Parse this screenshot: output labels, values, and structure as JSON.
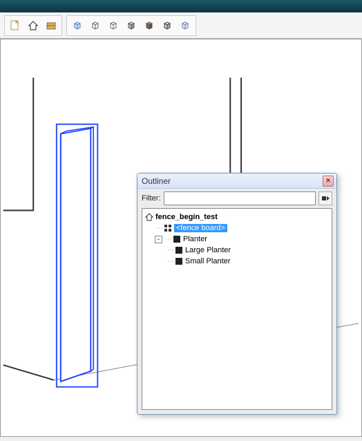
{
  "toolbar": {
    "std_buttons": [
      "new",
      "home",
      "save"
    ],
    "layer_buttons": [
      "iso",
      "wire",
      "hidden",
      "shaded",
      "shaded-tex",
      "mono",
      "xray"
    ]
  },
  "panel": {
    "title": "Outliner",
    "filter_label": "Filter:",
    "filter_value": "",
    "filter_placeholder": ""
  },
  "tree": {
    "root": {
      "label": "fence_begin_test",
      "icon": "home"
    },
    "items": [
      {
        "label": "<fence board>",
        "icon": "component",
        "selected": true,
        "depth": 1,
        "expander": "none"
      },
      {
        "label": "Planter",
        "icon": "group-solid",
        "selected": false,
        "depth": 1,
        "expander": "minus",
        "children": [
          {
            "label": "Large Planter",
            "icon": "group-solid",
            "depth": 2,
            "expander": "none"
          },
          {
            "label": "Small Planter",
            "icon": "group-solid",
            "depth": 2,
            "expander": "none"
          }
        ]
      }
    ]
  }
}
